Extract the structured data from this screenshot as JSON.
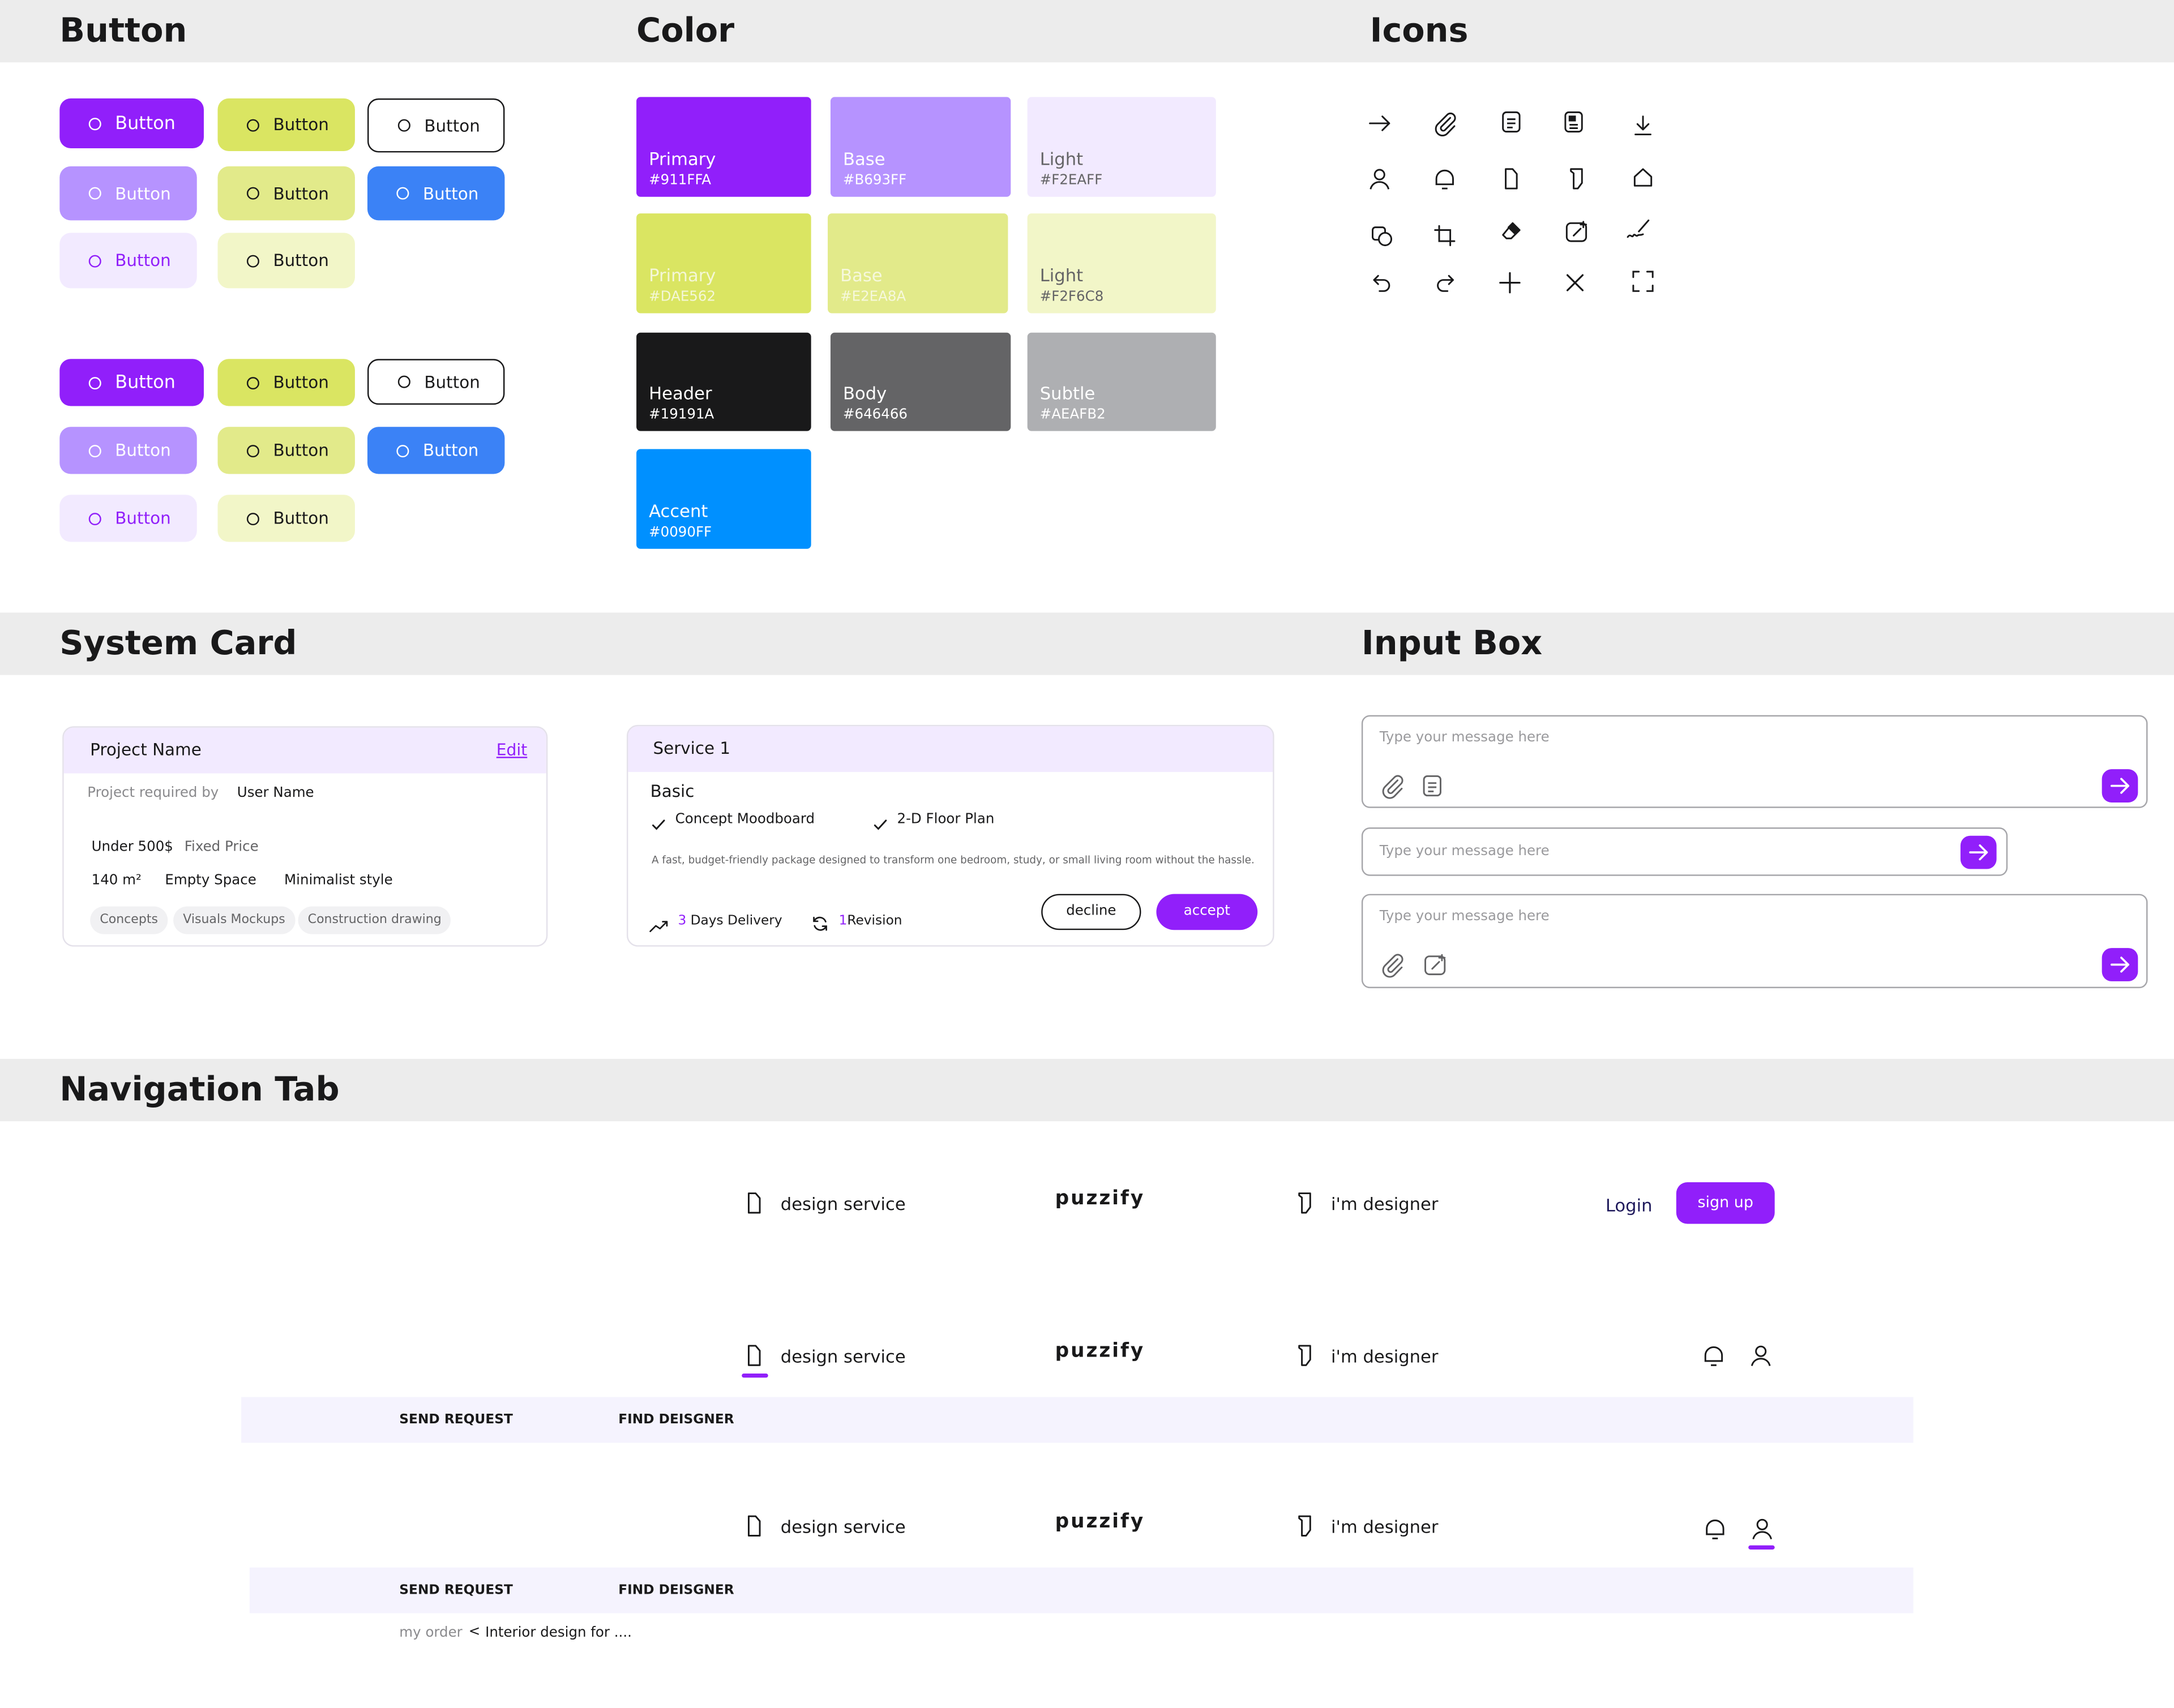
{
  "sections": {
    "button": "Button",
    "color": "Color",
    "icons": "Icons",
    "system_card": "System Card",
    "input_box": "Input Box",
    "navigation_tab": "Navigation Tab"
  },
  "buttons": {
    "label": "Button"
  },
  "colors": {
    "brand": "#911FFA",
    "accent": "#0090FF",
    "swatches": [
      {
        "name": "Primary",
        "hex": "#911FFA"
      },
      {
        "name": "Base",
        "hex": "#B693FF"
      },
      {
        "name": "Light",
        "hex": "#F2EAFF"
      },
      {
        "name": "Primary",
        "hex": "#DAE562"
      },
      {
        "name": "Base",
        "hex": "#E2EA8A"
      },
      {
        "name": "Light",
        "hex": "#F2F6C8"
      },
      {
        "name": "Header",
        "hex": "#19191A"
      },
      {
        "name": "Body",
        "hex": "#646466"
      },
      {
        "name": "Subtle",
        "hex": "#AEAFB2"
      },
      {
        "name": "Accent",
        "hex": "#0090FF"
      }
    ]
  },
  "icons": [
    "arrow-right-icon",
    "paperclip-icon",
    "document-icon",
    "document-filled-icon",
    "download-icon",
    "user-icon",
    "bell-icon",
    "file-icon",
    "designer-icon",
    "home-icon",
    "shapes-icon",
    "crop-icon",
    "eraser-icon",
    "edit-image-icon",
    "signature-icon",
    "undo-icon",
    "redo-icon",
    "plus-icon",
    "close-icon",
    "fullscreen-icon"
  ],
  "project_card": {
    "title": "Project Name",
    "edit": "Edit",
    "required_label": "Project required by",
    "user": "User Name",
    "budget": "Under 500$",
    "price_type": "Fixed Price",
    "area": "140 m²",
    "space": "Empty Space",
    "style": "Minimalist style",
    "chips": [
      "Concepts",
      "Visuals Mockups",
      "Construction drawing"
    ]
  },
  "service_card": {
    "title": "Service 1",
    "tier": "Basic",
    "features": [
      "Concept Moodboard",
      "2-D Floor Plan"
    ],
    "description": "A fast, budget-friendly package designed to transform one bedroom, study, or small living room without the hassle.",
    "delivery_num": "3",
    "delivery_text": "Days Delivery",
    "revision_num": "1",
    "revision_text": "Revision",
    "decline": "decline",
    "accept": "accept"
  },
  "input_box": {
    "placeholder": "Type your message here"
  },
  "nav": {
    "design_service": "design service",
    "logo": "puzzify",
    "designer": "i'm designer",
    "login": "Login",
    "signup": "sign up",
    "send_request": "SEND REQUEST",
    "find_designer": "FIND DEISGNER",
    "breadcrumb_root": "my order",
    "breadcrumb_sep": "<",
    "breadcrumb_current": "Interior design for ...."
  }
}
